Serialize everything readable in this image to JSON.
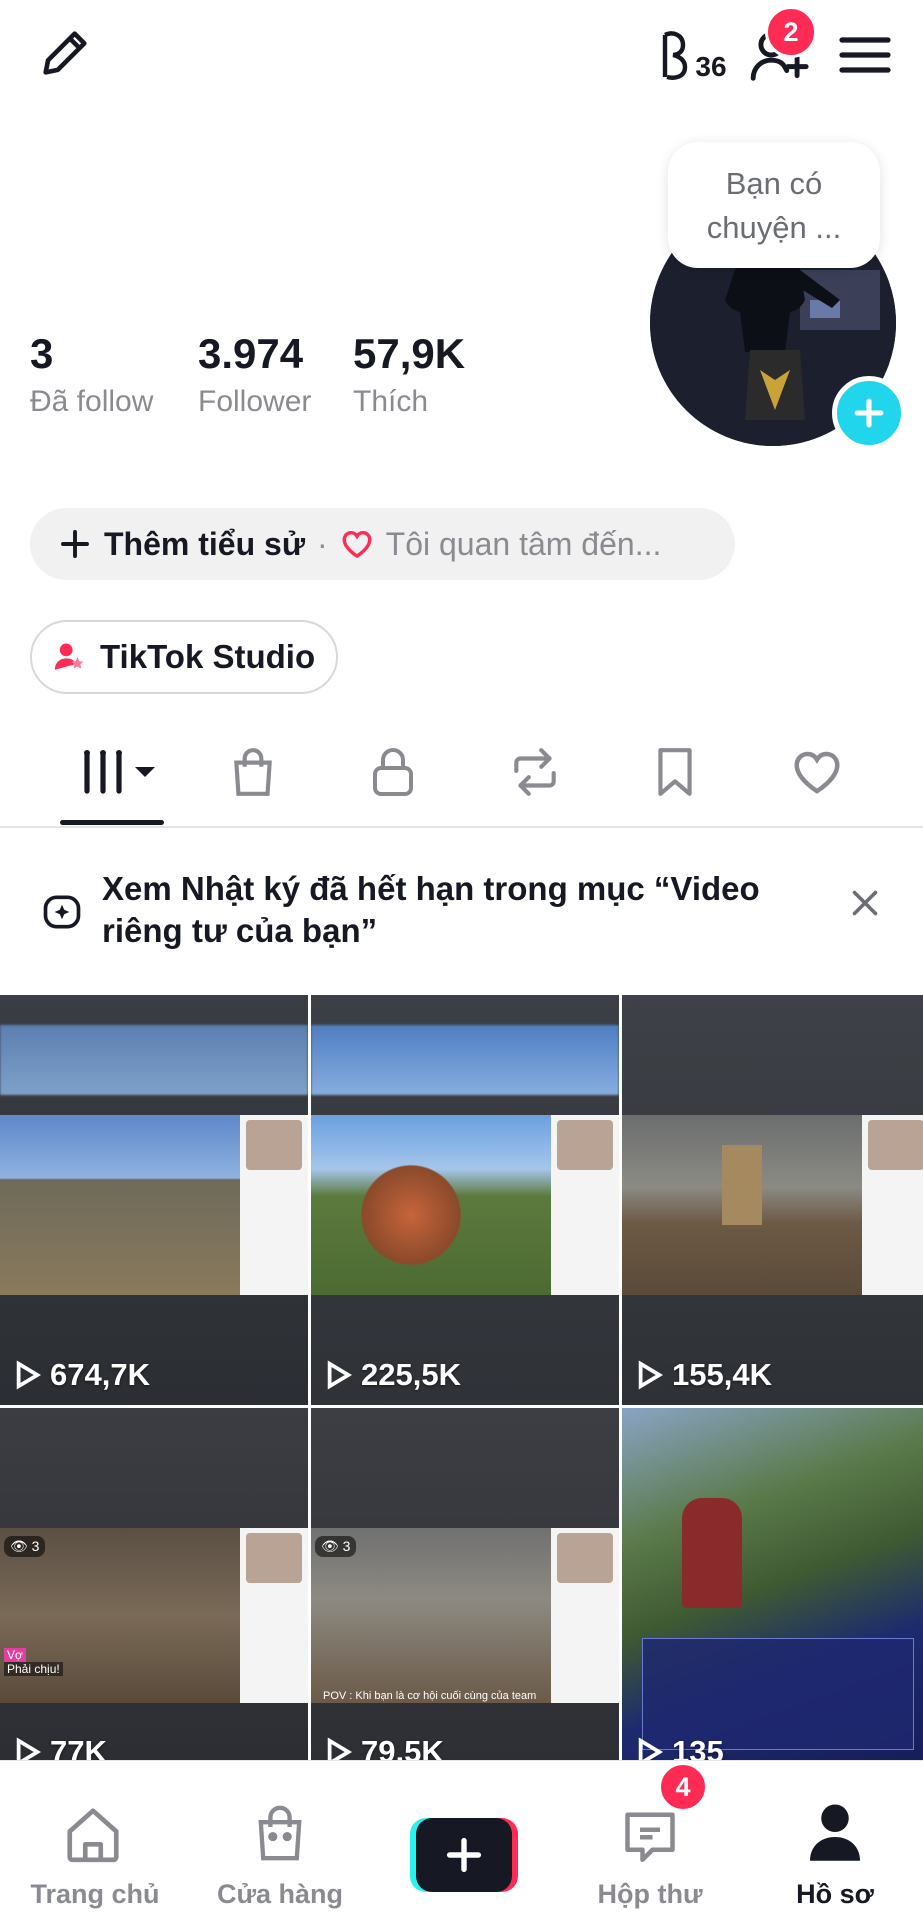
{
  "header": {
    "edit_icon": "pencil-icon",
    "streak_text": "36",
    "friend_request_count": "2",
    "menu_icon": "hamburger-icon"
  },
  "profile": {
    "bubble_text_line1": "Bạn có",
    "bubble_text_line2": "chuyện ..."
  },
  "stats": [
    {
      "value": "3",
      "label": "Đã follow"
    },
    {
      "value": "3.974",
      "label": "Follower"
    },
    {
      "value": "57,9K",
      "label": "Thích"
    }
  ],
  "bio": {
    "add_bio_label": "Thêm tiểu sử",
    "separator": "·",
    "interests_label": "Tôi quan tâm đến..."
  },
  "studio": {
    "label": "TikTok Studio"
  },
  "notice": {
    "text": "Xem Nhật ký đã hết hạn trong mục “Video riêng tư của bạn”"
  },
  "videos": [
    {
      "views": "674,7K"
    },
    {
      "views": "225,5K"
    },
    {
      "views": "155,4K"
    },
    {
      "views": "77K"
    },
    {
      "views": "79,5K"
    },
    {
      "views": "135"
    }
  ],
  "overlays": {
    "tile4_viewers": "3",
    "tile4_chat": "Phải chịu!",
    "tile4_chat_prefix": "Vợ",
    "tile5_viewers": "3",
    "tile5_caption": "POV : Khi bạn là cơ hội cuối cùng của team"
  },
  "nav": {
    "home": "Trang chủ",
    "shop": "Cửa hàng",
    "inbox": "Hộp thư",
    "inbox_badge": "4",
    "profile": "Hồ sơ"
  }
}
